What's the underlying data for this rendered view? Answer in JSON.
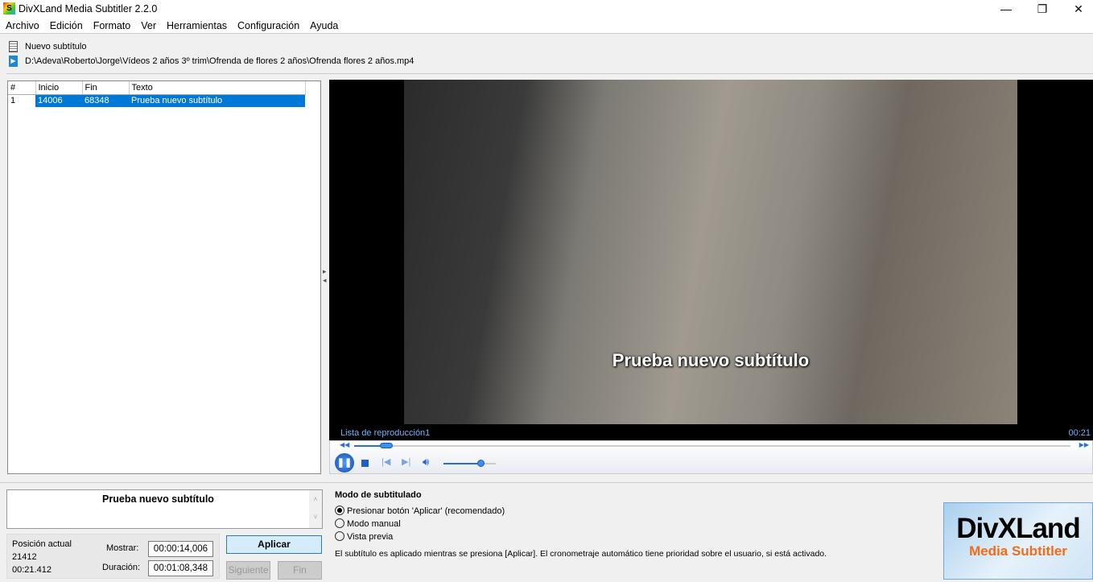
{
  "window": {
    "title": "DivXLand Media Subtitler 2.2.0",
    "minimize": "—",
    "maximize": "❐",
    "close": "✕"
  },
  "menu": [
    "Archivo",
    "Edición",
    "Formato",
    "Ver",
    "Herramientas",
    "Configuración",
    "Ayuda"
  ],
  "info": {
    "subtitle_file": "Nuevo subtítulo",
    "media_path": "D:\\Adeva\\Roberto\\Jorge\\Vídeos 2 años  3º trim\\Ofrenda de flores 2 años\\Ofrenda flores 2 años.mp4"
  },
  "table": {
    "headers": [
      "#",
      "Inicio",
      "Fin",
      "Texto"
    ],
    "rows": [
      {
        "n": "1",
        "inicio": "14006",
        "fin": "68348",
        "texto": "Prueba nuevo subtítulo"
      }
    ]
  },
  "player": {
    "subtitle_overlay": "Prueba nuevo subtítulo",
    "playlist": "Lista de reproducción1",
    "time": "00:21",
    "seek_fraction": 0.045,
    "volume_fraction": 0.7
  },
  "editor": {
    "text": "Prueba nuevo subtítulo",
    "position_label": "Posición actual",
    "position_ms": "21412",
    "position_time": "00:21.412",
    "show_label": "Mostrar:",
    "show_value": "00:00:14,006",
    "duration_label": "Duración:",
    "duration_value": "00:01:08,348",
    "apply": "Aplicar",
    "next": "Siguiente",
    "end": "Fin"
  },
  "mode": {
    "title": "Modo de subtitulado",
    "options": [
      "Presionar botón 'Aplicar' (recomendado)",
      "Modo manual",
      "Vista previa"
    ],
    "selected": 0,
    "note": "El subtítulo es aplicado mientras se presiona [Aplicar]. El cronometraje automático tiene prioridad sobre el usuario, si está activado."
  },
  "logo": {
    "line1": "DivXLand",
    "line2": "Media Subtitler"
  }
}
